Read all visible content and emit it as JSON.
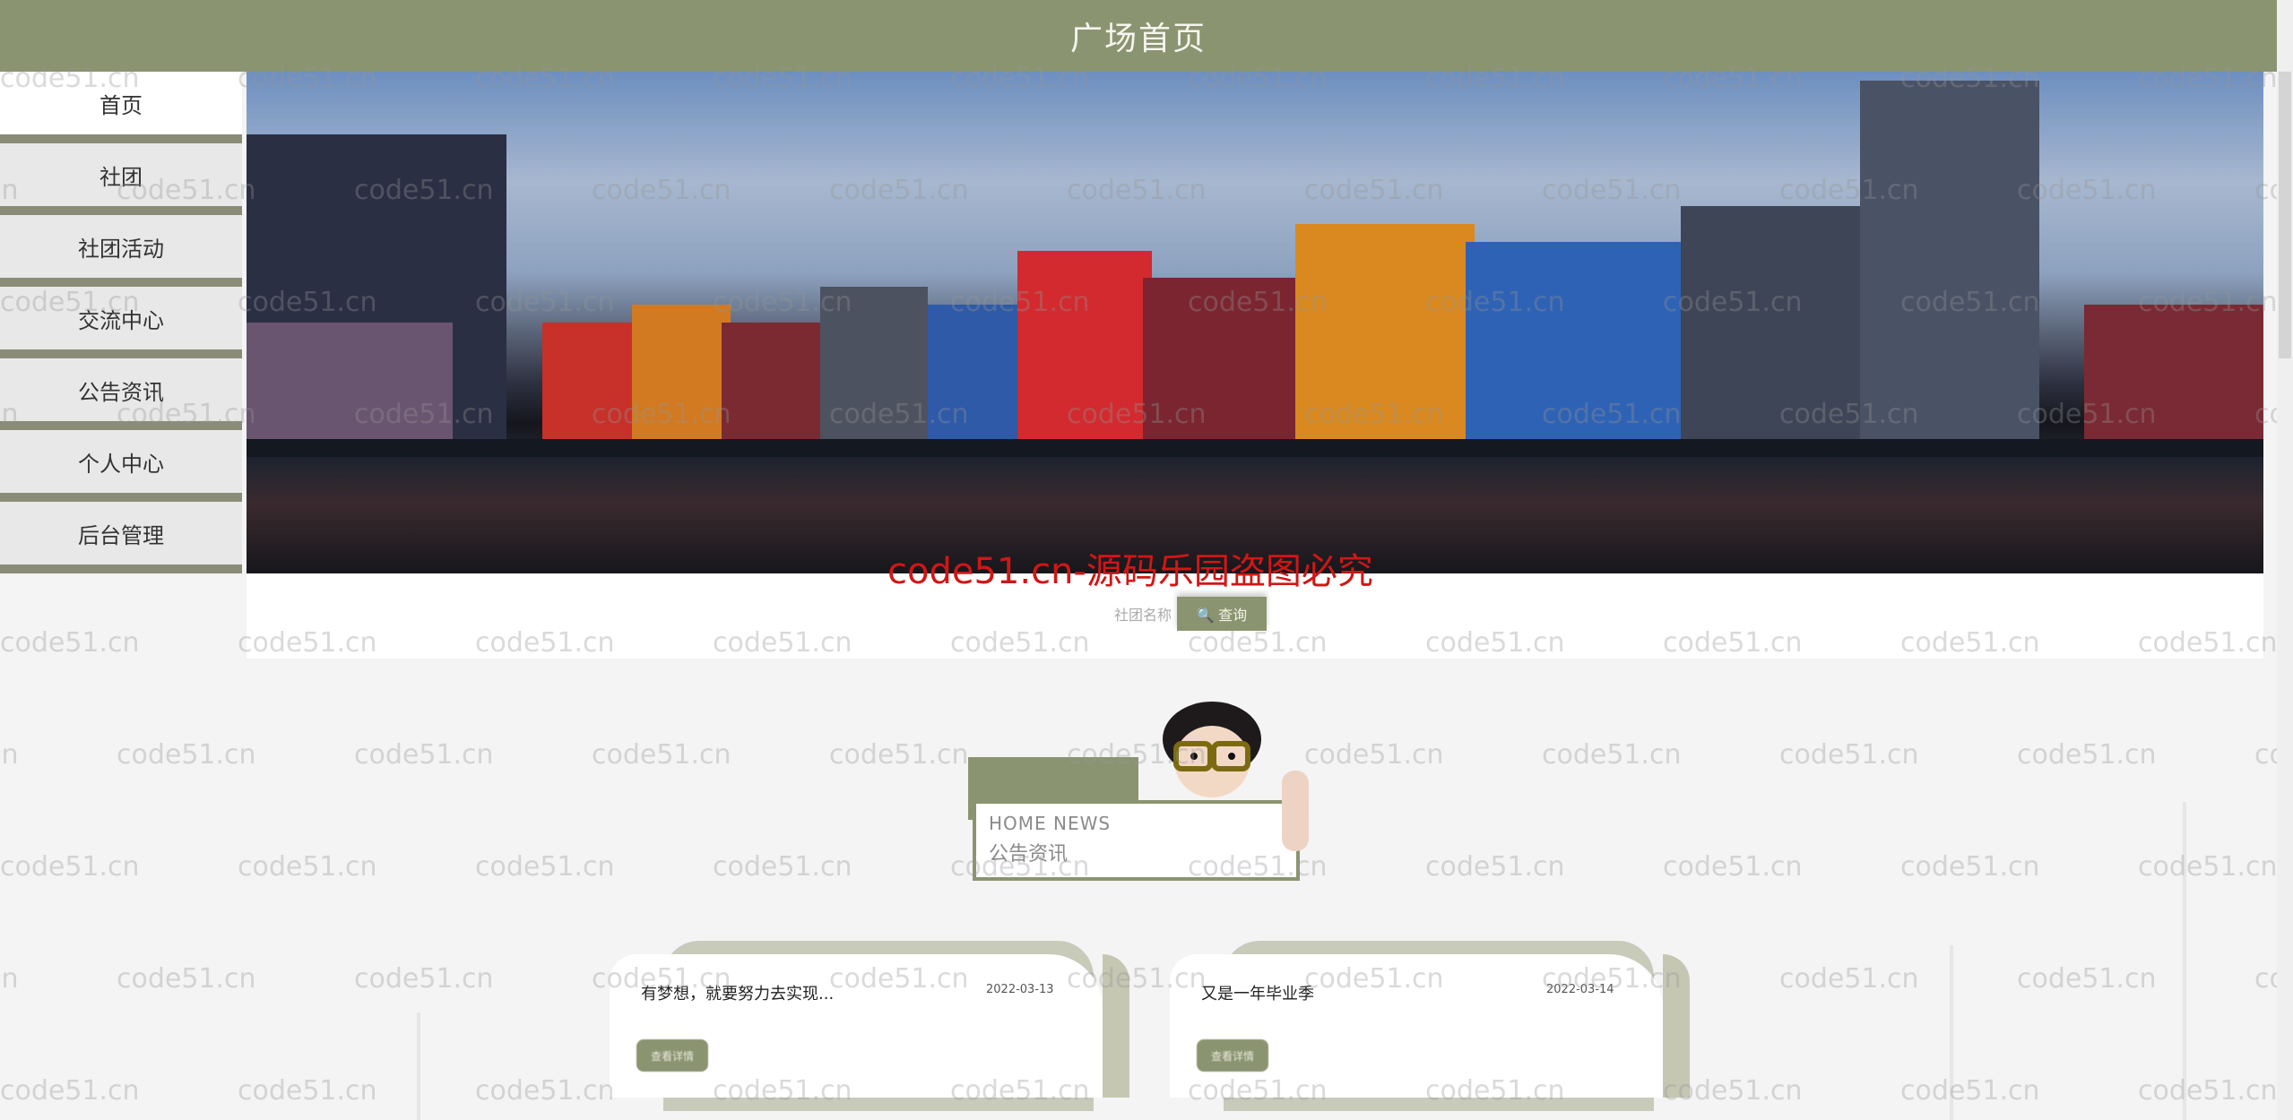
{
  "header": {
    "title": "广场首页"
  },
  "sidebar": {
    "items": [
      {
        "label": "首页",
        "active": true
      },
      {
        "label": "社团"
      },
      {
        "label": "社团活动"
      },
      {
        "label": "交流中心"
      },
      {
        "label": "公告资讯"
      },
      {
        "label": "个人中心"
      },
      {
        "label": "后台管理"
      }
    ]
  },
  "search": {
    "placeholder": "社团名称",
    "button_label": "🔍 查询"
  },
  "overlay_watermark": "code51.cn-源码乐园盗图必究",
  "tile_watermark": "code51.cn",
  "news": {
    "heading_en": "HOME NEWS",
    "heading_zh": "公告资讯",
    "items": [
      {
        "title": "有梦想，就要努力去实现...",
        "date": "2022-03-13",
        "button_label": "查看详情"
      },
      {
        "title": "又是一年毕业季",
        "date": "2022-03-14",
        "button_label": "查看详情"
      }
    ]
  },
  "colors": {
    "accent": "#8b9470",
    "sidebar_divider": "#8b8c78",
    "watermark_red": "#d11616"
  }
}
